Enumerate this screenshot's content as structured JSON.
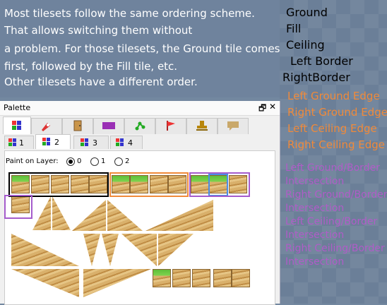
{
  "info": {
    "lines": [
      "Most tilesets follow the same ordering scheme.",
      "That allows switching them without",
      "a problem. For those tilesets, the Ground tile comes",
      "first, followed by the Fill tile, etc.",
      "Other tilesets have a different order."
    ]
  },
  "legend": {
    "basic": [
      "Ground",
      "Fill",
      "Ceiling",
      "Left Border",
      "RightBorder"
    ],
    "edges": [
      "Left Ground Edge",
      "Right Ground Edge",
      "Left Ceiling Edge",
      "Right Ceiling Edge"
    ],
    "intersections": [
      "Left Ground/Border",
      "Intersection",
      "Right Ground/Border",
      "Intersection",
      "Left Ceiling/Border",
      "Intersection",
      "Right Ceiling/Border",
      "Intersection"
    ]
  },
  "palette": {
    "title": "Palette",
    "restore_glyph": "🗗",
    "close_glyph": "✕",
    "tabs": [
      "tiles-icon",
      "rocket-icon",
      "door-icon",
      "rectangle-icon",
      "nodes-icon",
      "flag-icon",
      "stamp-icon",
      "comment-icon"
    ],
    "subtabs": [
      "1",
      "2",
      "3",
      "4"
    ],
    "selected_subtab": "2",
    "paint_on_layer": "Paint on Layer:",
    "layers": [
      "0",
      "1",
      "2"
    ],
    "selected_layer": "0"
  },
  "colors": {
    "black": "#000000",
    "orange": "#f08a3a",
    "blue": "#4a8ee8",
    "purple": "#a55ccc"
  }
}
